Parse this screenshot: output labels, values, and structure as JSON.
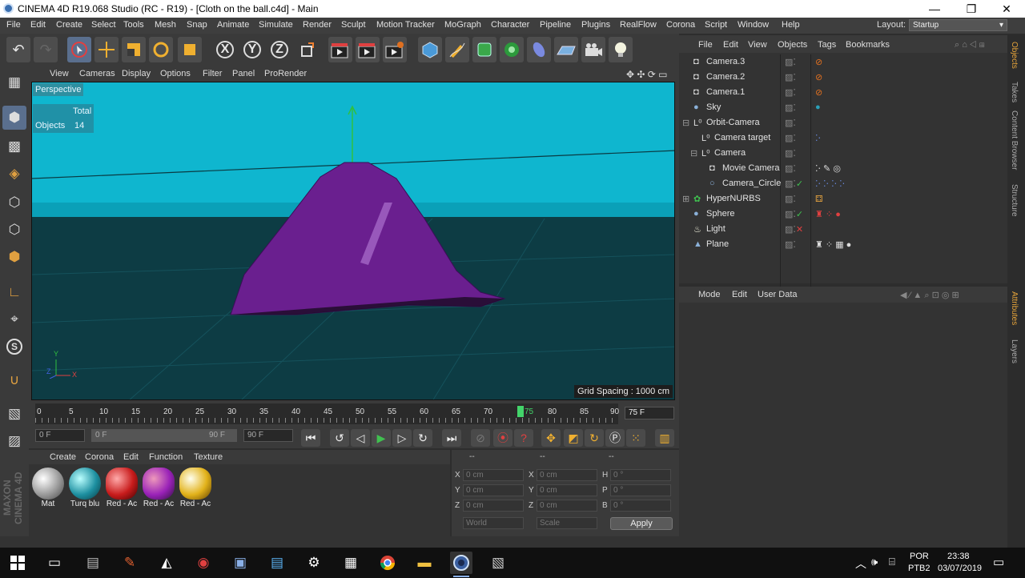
{
  "window": {
    "title": "CINEMA 4D R19.068 Studio (RC - R19) - [Cloth on the ball.c4d] - Main",
    "minimize": "—",
    "restore": "❐",
    "close": "✕"
  },
  "menubar": {
    "items": [
      "File",
      "Edit",
      "Create",
      "Select",
      "Tools",
      "Mesh",
      "Snap",
      "Animate",
      "Simulate",
      "Render",
      "Sculpt",
      "Motion Tracker",
      "MoGraph",
      "Character",
      "Pipeline",
      "Plugins",
      "RealFlow",
      "Corona",
      "Script",
      "Window",
      "Help"
    ],
    "layout_label": "Layout:",
    "layout_value": "Startup"
  },
  "toolbar": {
    "axis_x": "X",
    "axis_y": "Y",
    "axis_z": "Z"
  },
  "viewport": {
    "menu": [
      "View",
      "Cameras",
      "Display",
      "Options",
      "Filter",
      "Panel",
      "ProRender"
    ],
    "label": "Perspective",
    "stats_header": "Total",
    "stats_label": "Objects",
    "stats_value": "14",
    "grid_spacing": "Grid Spacing : 1000 cm",
    "axis_y": "Y",
    "axis_x": "X",
    "axis_z": "Z",
    "sky_color": "#0fb6cf",
    "ground_color": "#0d3c44",
    "cloth_color": "#6a1f8f"
  },
  "timeline": {
    "ticks": [
      "0",
      "5",
      "10",
      "15",
      "20",
      "25",
      "30",
      "35",
      "40",
      "45",
      "50",
      "55",
      "60",
      "65",
      "70",
      "75",
      "80",
      "85",
      "90"
    ],
    "current_frame": "75",
    "frame_field": "75 F",
    "start_field": "0 F",
    "range_start": "0 F",
    "range_end": "90 F",
    "end_field": "90 F"
  },
  "materials": {
    "menu": [
      "Create",
      "Corona",
      "Edit",
      "Function",
      "Texture"
    ],
    "items": [
      {
        "name": "Mat",
        "color": "#bdbdbd"
      },
      {
        "name": "Turq blu",
        "color": "#1d8fa0"
      },
      {
        "name": "Red - Ac",
        "color": "#c81c1c"
      },
      {
        "name": "Red - Ac",
        "color": "#9a22b8"
      },
      {
        "name": "Red - Ac",
        "color": "#e2b21a"
      }
    ]
  },
  "coords": {
    "header": [
      "--",
      "--",
      "--"
    ],
    "rows": [
      {
        "l1": "X",
        "v1": "0 cm",
        "l2": "X",
        "v2": "0 cm",
        "l3": "H",
        "v3": "0 °"
      },
      {
        "l1": "Y",
        "v1": "0 cm",
        "l2": "Y",
        "v2": "0 cm",
        "l3": "P",
        "v3": "0 °"
      },
      {
        "l1": "Z",
        "v1": "0 cm",
        "l2": "Z",
        "v2": "0 cm",
        "l3": "B",
        "v3": "0 °"
      }
    ],
    "mode1": "World",
    "mode2": "Scale",
    "apply": "Apply"
  },
  "objects": {
    "menu": [
      "File",
      "Edit",
      "View",
      "Objects",
      "Tags",
      "Bookmarks"
    ],
    "items": [
      {
        "name": "Camera.3",
        "icon": "camera-icon",
        "level": 0
      },
      {
        "name": "Camera.2",
        "icon": "camera-icon",
        "level": 0
      },
      {
        "name": "Camera.1",
        "icon": "camera-icon",
        "level": 0
      },
      {
        "name": "Sky",
        "icon": "sky-icon",
        "level": 0
      },
      {
        "name": "Orbit-Camera",
        "icon": "null-icon",
        "level": 0
      },
      {
        "name": "Camera target",
        "icon": "null-icon",
        "level": 1
      },
      {
        "name": "Camera",
        "icon": "null-icon",
        "level": 1
      },
      {
        "name": "Movie Camera",
        "icon": "camera-icon",
        "level": 2
      },
      {
        "name": "Camera_Circle",
        "icon": "circle-spline-icon",
        "level": 2
      },
      {
        "name": "HyperNURBS",
        "icon": "hypernurbs-icon",
        "level": 0
      },
      {
        "name": "Sphere",
        "icon": "sphere-icon",
        "level": 0
      },
      {
        "name": "Light",
        "icon": "light-icon",
        "level": 0
      },
      {
        "name": "Plane",
        "icon": "plane-icon",
        "level": 0
      }
    ]
  },
  "attributes": {
    "menu": [
      "Mode",
      "Edit",
      "User Data"
    ]
  },
  "side_tabs": [
    "Objects",
    "Takes",
    "Content Browser",
    "Structure"
  ],
  "side_tabs2": [
    "Attributes",
    "Layers"
  ],
  "brand": "MAXON CINEMA 4D",
  "taskbar": {
    "lang1": "POR",
    "lang2": "PTB2",
    "time": "23:38",
    "date": "03/07/2019"
  }
}
